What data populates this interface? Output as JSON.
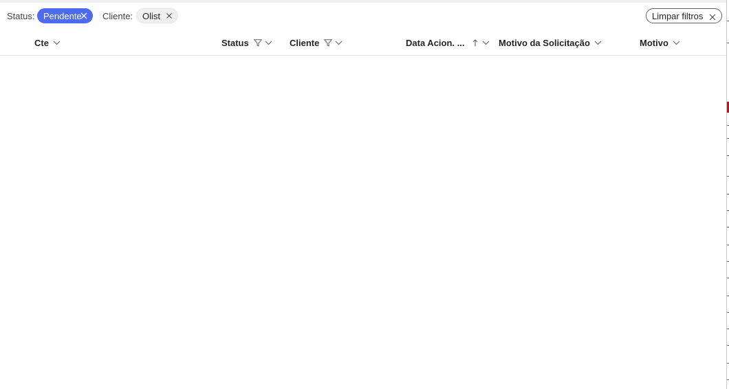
{
  "filters": {
    "status_label": "Status:",
    "status_value": "Pendente",
    "cliente_label": "Cliente:",
    "cliente_value": "Olist",
    "clear_label": "Limpar filtros"
  },
  "columns": [
    {
      "label": "Cte"
    },
    {
      "label": "Status"
    },
    {
      "label": "Cliente"
    },
    {
      "label": "Data Acion. ..."
    },
    {
      "label": "Motivo da Solicitação"
    },
    {
      "label": "Motivo"
    }
  ],
  "colors": {
    "accent": "#4f6bed",
    "chip_neutral": "#f0f0f0",
    "text": "#242424"
  },
  "icons": {
    "chip_remove": "close-icon",
    "filter": "filter-icon",
    "sort": "chevron-down-icon",
    "sort_asc": "arrow-up-icon"
  }
}
